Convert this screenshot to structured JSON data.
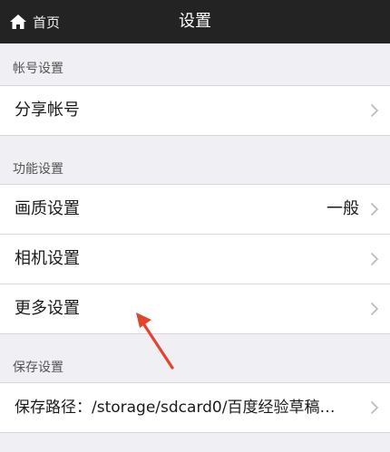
{
  "header": {
    "back_label": "首页",
    "title": "设置"
  },
  "sections": {
    "account": {
      "header": "帐号设置",
      "items": [
        {
          "label": "分享帐号"
        }
      ]
    },
    "function": {
      "header": "功能设置",
      "items": [
        {
          "label": "画质设置",
          "value": "一般"
        },
        {
          "label": "相机设置"
        },
        {
          "label": "更多设置"
        }
      ]
    },
    "save": {
      "header": "保存设置",
      "items": [
        {
          "label": "保存路径：",
          "value": "/storage/sdcard0/百度经验草稿…"
        }
      ]
    }
  },
  "colors": {
    "topbar": "#232323",
    "background": "#efeff4",
    "row": "#ffffff",
    "annotation_arrow": "#e2452f"
  },
  "icons": {
    "back": "home-icon",
    "chevron": "chevron-right-icon",
    "annotation": "red-arrow-annotation"
  }
}
